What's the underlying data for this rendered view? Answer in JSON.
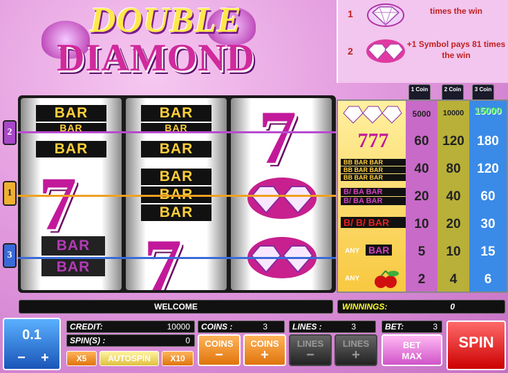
{
  "logo": {
    "word1": "DOUBLE",
    "word2": "DIAMOND"
  },
  "top_paytable": [
    {
      "num": "1",
      "text": "times the win"
    },
    {
      "num": "2",
      "text": "+1 Symbol pays 81 times the win"
    }
  ],
  "paylines": [
    "2",
    "1",
    "3"
  ],
  "coin_headers": [
    "1 Coin",
    "2 Coin",
    "3 Coin"
  ],
  "reel_symbols": {
    "bar": "BAR"
  },
  "paytable_rows": [
    {
      "symbol": "3 diamonds",
      "c1": "5000",
      "c2": "10000",
      "c3": "15000"
    },
    {
      "symbol": "3 sevens",
      "c1": "60",
      "c2": "120",
      "c3": "180"
    },
    {
      "symbol": "3 triple bars",
      "c1": "40",
      "c2": "80",
      "c3": "120"
    },
    {
      "symbol": "3 double bars",
      "c1": "20",
      "c2": "40",
      "c3": "60"
    },
    {
      "symbol": "3 single bars",
      "c1": "10",
      "c2": "20",
      "c3": "30"
    },
    {
      "symbol": "any bar",
      "c1": "5",
      "c2": "10",
      "c3": "15"
    },
    {
      "symbol": "any cherry",
      "c1": "2",
      "c2": "4",
      "c3": "6"
    }
  ],
  "any_label": "ANY",
  "bar_label": "BAR",
  "status": {
    "welcome": "WELCOME",
    "winnings_label": "WINNINGS:",
    "winnings_value": "0"
  },
  "controls": {
    "coin_value": "0.1",
    "credit_label": "CREDIT:",
    "credit_value": "10000",
    "spins_label": "SPIN(S) :",
    "spins_value": "0",
    "coins_label": "COINS :",
    "coins_value": "3",
    "lines_label": "LINES :",
    "lines_value": "3",
    "bet_label": "BET:",
    "bet_value": "3",
    "x5": "X5",
    "autospin": "AUTOSPIN",
    "x10": "X10",
    "coins_minus": "COINS",
    "coins_plus": "COINS",
    "lines_minus": "LINES",
    "lines_plus": "LINES",
    "bet_max_1": "BET",
    "bet_max_2": "MAX",
    "spin": "SPIN",
    "minus": "−",
    "plus": "+"
  }
}
